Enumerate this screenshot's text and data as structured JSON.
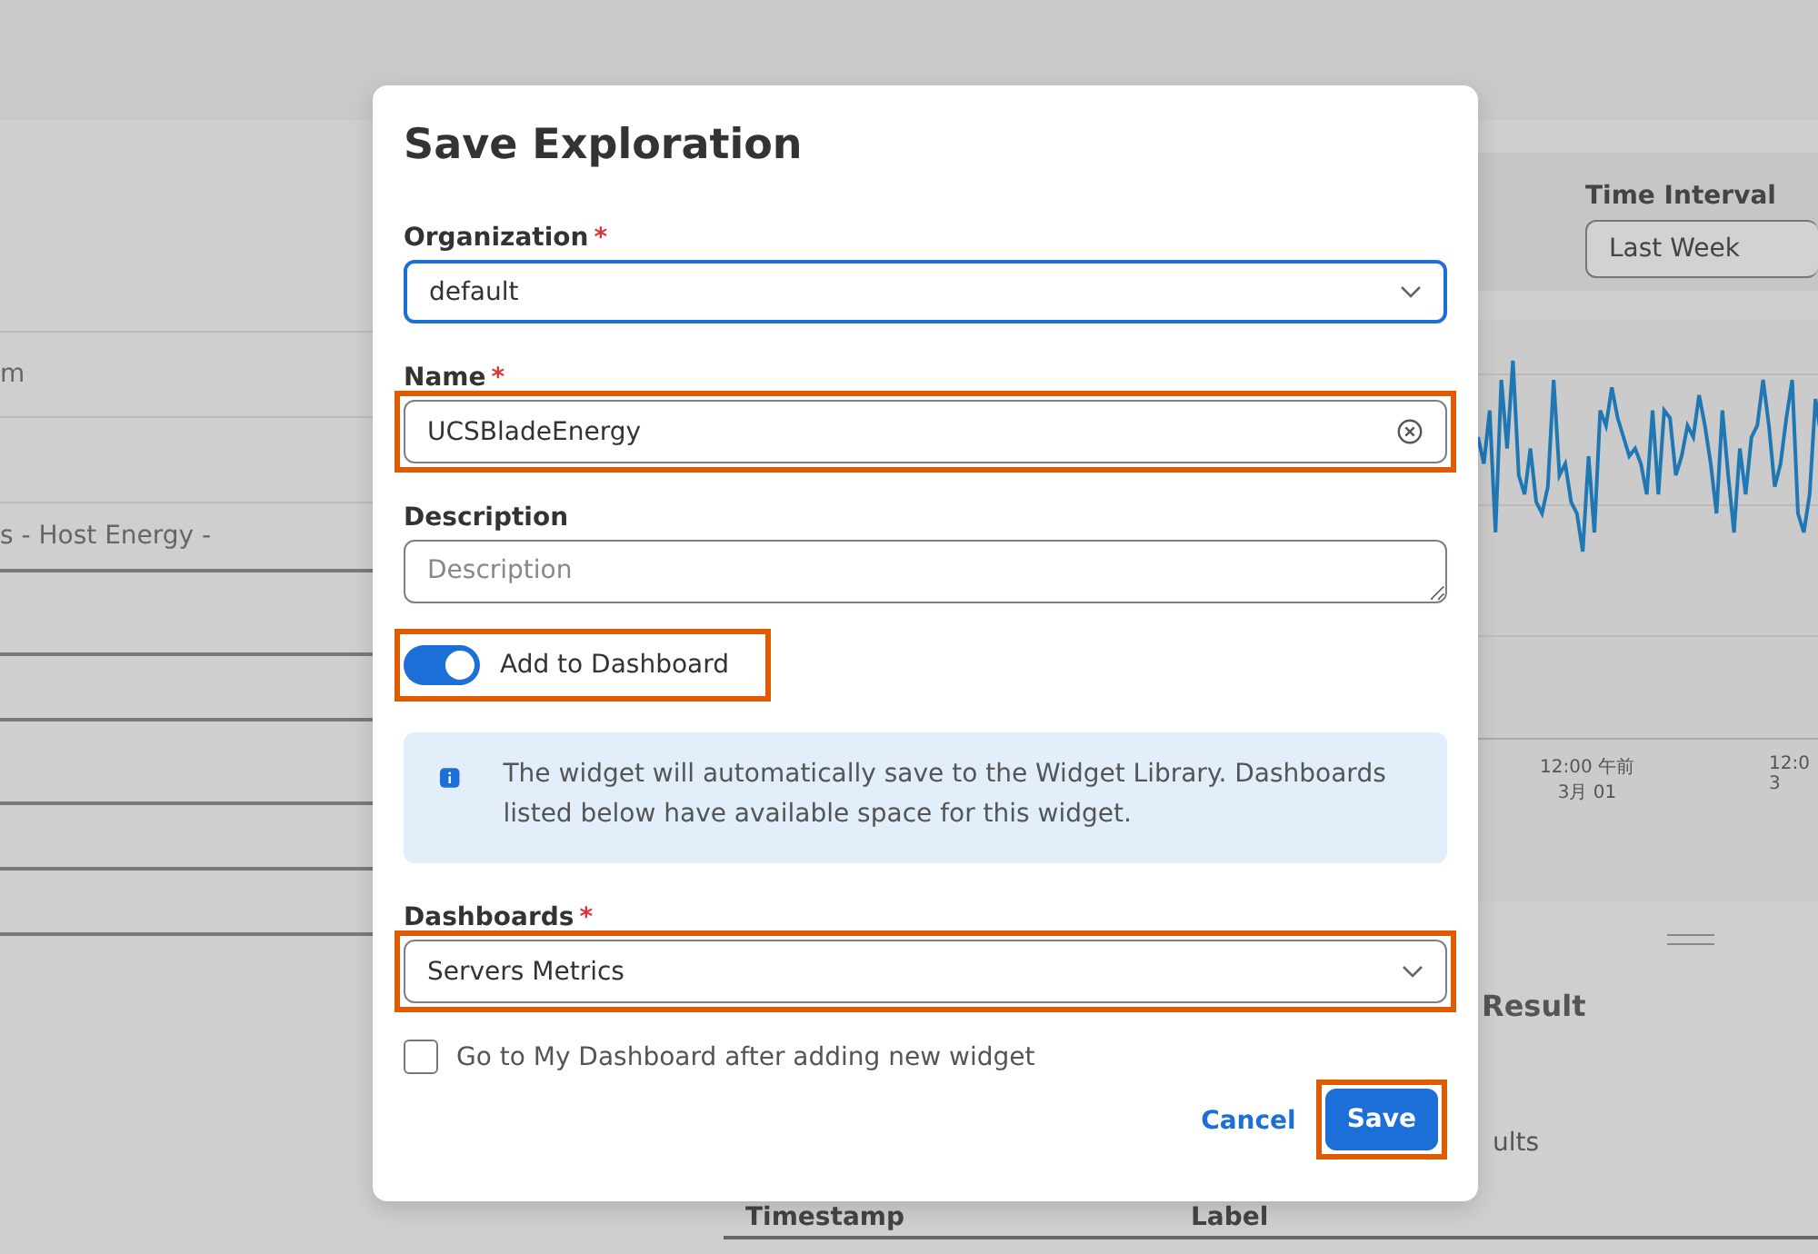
{
  "background": {
    "left_rows": [
      {
        "text": "m"
      },
      {
        "text": "s - Host Energy -"
      }
    ],
    "time_interval": {
      "label": "Time Interval",
      "value": "Last Week"
    },
    "chart_ticks": [
      {
        "time": "12:00 午前",
        "date": "3月 01"
      },
      {
        "time": "12:0",
        "date": "3"
      }
    ],
    "result_heading": "Result",
    "results_text": "ults",
    "table_columns": [
      "Timestamp",
      "Label"
    ]
  },
  "dialog": {
    "title": "Save Exploration",
    "organization": {
      "label": "Organization",
      "required_mark": "*",
      "value": "default",
      "focused": true
    },
    "name": {
      "label": "Name",
      "required_mark": "*",
      "value": "UCSBladeEnergy",
      "highlighted": true
    },
    "description": {
      "label": "Description",
      "placeholder": "Description"
    },
    "add_to_dashboard": {
      "label": "Add to Dashboard",
      "on": true,
      "highlighted": true
    },
    "info": "The widget will automatically save to the Widget Library. Dashboards listed below have available space for this widget.",
    "dashboards": {
      "label": "Dashboards",
      "required_mark": "*",
      "value": "Servers Metrics",
      "highlighted": true
    },
    "go_to_dashboard": {
      "label": "Go to My Dashboard after adding new widget",
      "checked": false
    },
    "buttons": [
      {
        "label": "Cancel",
        "kind": "link",
        "highlighted": false
      },
      {
        "label": "Save",
        "kind": "primary",
        "highlighted": true
      }
    ]
  }
}
